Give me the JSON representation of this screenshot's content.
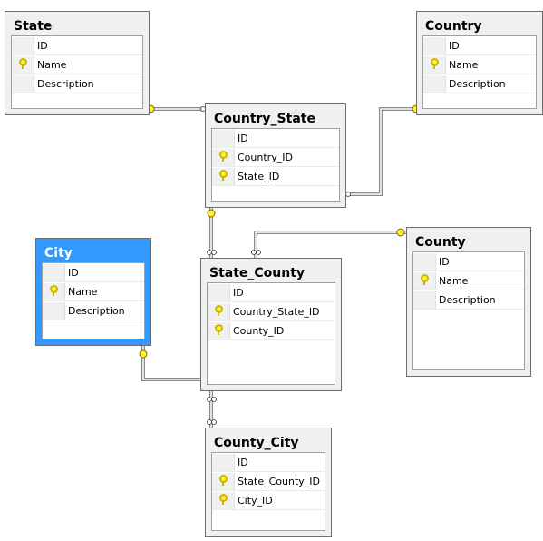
{
  "colors": {
    "selected_table": "#3399ff",
    "key": "#ffef3a",
    "line": "#8a8a8a"
  },
  "tables": [
    {
      "id": "state",
      "name": "State",
      "selected": false,
      "columns": [
        {
          "name": "ID",
          "key": false
        },
        {
          "name": "Name",
          "key": true
        },
        {
          "name": "Description",
          "key": false
        }
      ]
    },
    {
      "id": "country",
      "name": "Country",
      "selected": false,
      "columns": [
        {
          "name": "ID",
          "key": false
        },
        {
          "name": "Name",
          "key": true
        },
        {
          "name": "Description",
          "key": false
        }
      ]
    },
    {
      "id": "country-state",
      "name": "Country_State",
      "selected": false,
      "columns": [
        {
          "name": "ID",
          "key": false
        },
        {
          "name": "Country_ID",
          "key": true
        },
        {
          "name": "State_ID",
          "key": true
        }
      ]
    },
    {
      "id": "city",
      "name": "City",
      "selected": true,
      "columns": [
        {
          "name": "ID",
          "key": false
        },
        {
          "name": "Name",
          "key": true
        },
        {
          "name": "Description",
          "key": false
        }
      ]
    },
    {
      "id": "state-county",
      "name": "State_County",
      "selected": false,
      "columns": [
        {
          "name": "ID",
          "key": false
        },
        {
          "name": "Country_State_ID",
          "key": true
        },
        {
          "name": "County_ID",
          "key": true
        }
      ]
    },
    {
      "id": "county",
      "name": "County",
      "selected": false,
      "columns": [
        {
          "name": "ID",
          "key": false
        },
        {
          "name": "Name",
          "key": true
        },
        {
          "name": "Description",
          "key": false
        }
      ]
    },
    {
      "id": "county-city",
      "name": "County_City",
      "selected": false,
      "columns": [
        {
          "name": "ID",
          "key": false
        },
        {
          "name": "State_County_ID",
          "key": true
        },
        {
          "name": "City_ID",
          "key": true
        }
      ]
    }
  ]
}
